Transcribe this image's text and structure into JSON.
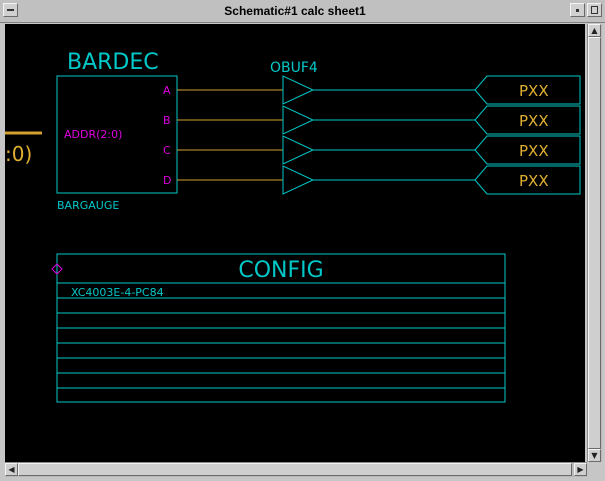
{
  "window": {
    "title": "Schematic#1 calc sheet1"
  },
  "schematic": {
    "offpage_label": ":0)",
    "bardec": {
      "name": "BARDEC",
      "input_pin": "ADDR(2:0)",
      "outputs": [
        "A",
        "B",
        "C",
        "D"
      ],
      "footer": "BARGAUGE"
    },
    "obuf": {
      "name": "OBUF4"
    },
    "pads": [
      "PXX",
      "PXX",
      "PXX",
      "PXX"
    ],
    "config": {
      "title": "CONFIG",
      "rows": [
        "XC4003E-4-PC84",
        "",
        "",
        "",
        "",
        "",
        "",
        "",
        ""
      ]
    }
  },
  "colors": {
    "background": "#000000",
    "symbol_outline": "#00c8c8",
    "wire": "#d2a030",
    "pin_label": "#e000e0",
    "pad_label": "#e0b030"
  },
  "icons": {
    "window_menu": "minus-bar-icon",
    "minimize": "small-square-icon",
    "maximize": "large-square-icon",
    "scroll_up": "arrow-up-icon",
    "scroll_down": "arrow-down-icon",
    "scroll_left": "arrow-left-icon",
    "scroll_right": "arrow-right-icon"
  }
}
